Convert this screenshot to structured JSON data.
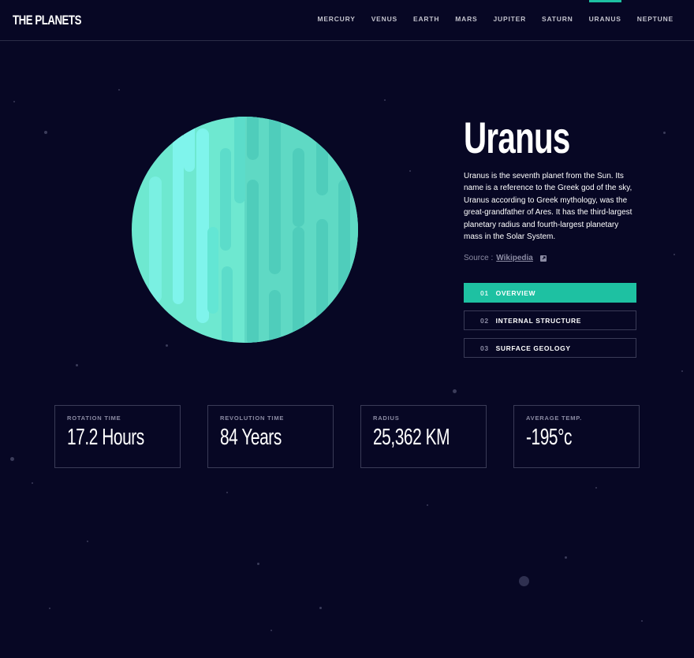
{
  "header": {
    "logo": "THE PLANETS",
    "nav": [
      "MERCURY",
      "VENUS",
      "EARTH",
      "MARS",
      "JUPITER",
      "SATURN",
      "URANUS",
      "NEPTUNE"
    ],
    "active_nav": "URANUS"
  },
  "planet": {
    "name": "Uranus",
    "description": "Uranus is the seventh planet from the Sun. Its name is a reference to the Greek god of the sky, Uranus according to Greek mythology, was the great-grandfather of Ares. It has the third-largest planetary radius and fourth-largest planetary mass in the Solar System.",
    "source_label": "Source :",
    "source_link": "Wikipedia",
    "image_icon": "uranus-planet-illustration"
  },
  "tabs": [
    {
      "num": "01",
      "label": "OVERVIEW",
      "active": true
    },
    {
      "num": "02",
      "label": "INTERNAL STRUCTURE",
      "active": false
    },
    {
      "num": "03",
      "label": "SURFACE GEOLOGY",
      "active": false
    }
  ],
  "stats": [
    {
      "label": "ROTATION TIME",
      "value": "17.2 Hours"
    },
    {
      "label": "REVOLUTION TIME",
      "value": "84 Years"
    },
    {
      "label": "RADIUS",
      "value": "25,362 KM"
    },
    {
      "label": "AVERAGE TEMP.",
      "value": "-195°c"
    }
  ],
  "colors": {
    "background": "#070724",
    "accent": "#1ec1a2",
    "planet_light": "#6ee8d0",
    "planet_dark": "#4fcdbb",
    "border": "#3a3b57"
  }
}
